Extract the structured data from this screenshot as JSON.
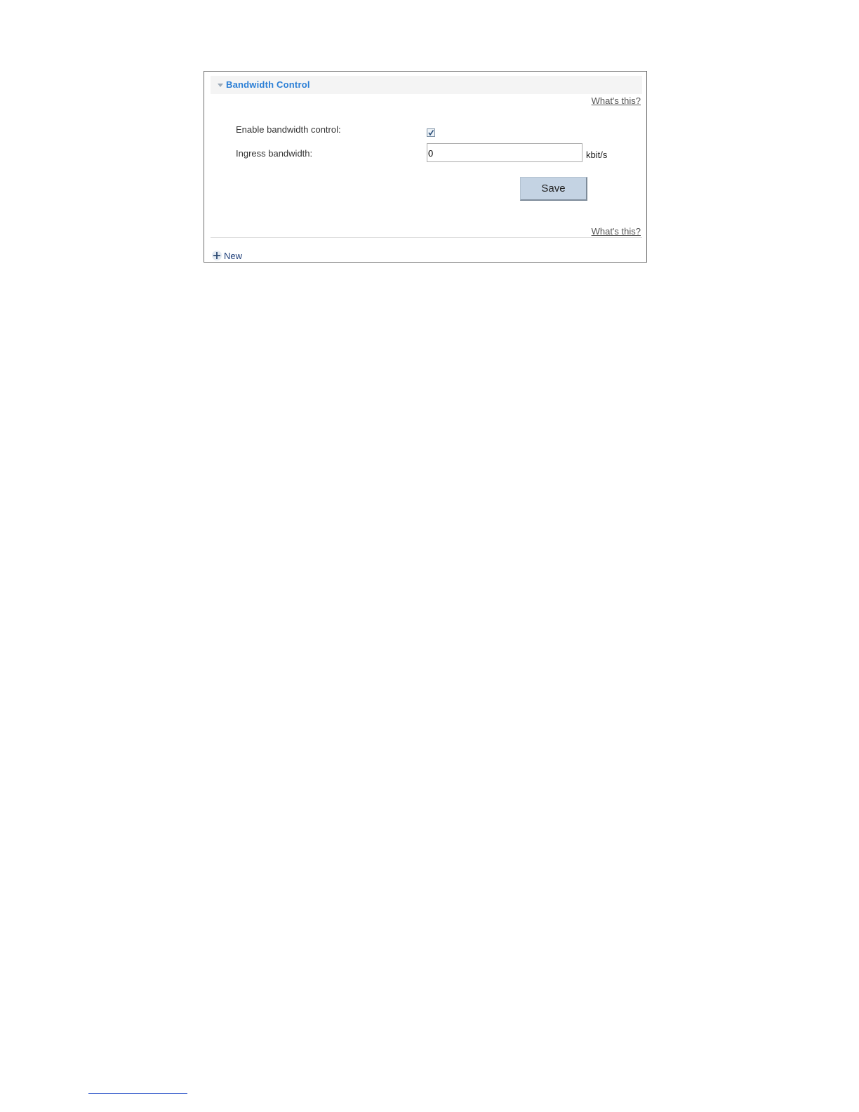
{
  "panel": {
    "title": "Bandwidth Control",
    "help_link_label": "What's this?"
  },
  "form": {
    "enable_label": "Enable bandwidth control:",
    "enable_checked": true,
    "ingress_label": "Ingress bandwidth:",
    "ingress_value": "0",
    "ingress_unit": "kbit/s",
    "save_label": "Save"
  },
  "footer": {
    "new_label": "New"
  },
  "icons": {
    "collapse": "triangle-down-icon",
    "add": "plus-icon"
  },
  "colors": {
    "title": "#2b7fd6",
    "button": "#c4d3e3",
    "new_link": "#1f3f7a"
  }
}
